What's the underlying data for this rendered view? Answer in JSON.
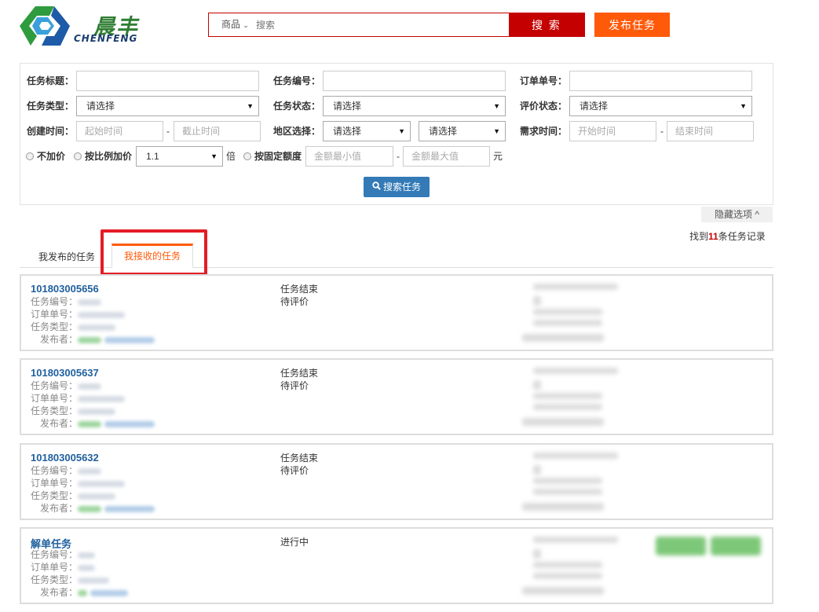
{
  "header": {
    "logo_cn": "晨丰",
    "logo_en": "CHENFENG",
    "search_category": "商品",
    "search_placeholder": "搜索",
    "search_button": "搜 索",
    "publish_button": "发布任务"
  },
  "filters": {
    "task_title_label": "任务标题：",
    "task_no_label": "任务编号：",
    "order_no_label": "订单单号：",
    "task_type_label": "任务类型：",
    "task_type_value": "请选择",
    "task_status_label": "任务状态：",
    "task_status_value": "请选择",
    "review_status_label": "评价状态：",
    "review_status_value": "请选择",
    "create_time_label": "创建时间：",
    "start_time_placeholder": "起始时间",
    "end_time_placeholder": "截止时间",
    "region_label": "地区选择：",
    "region_value_1": "请选择",
    "region_value_2": "请选择",
    "demand_time_label": "需求时间：",
    "demand_start_placeholder": "开始时间",
    "demand_end_placeholder": "结束时间",
    "radio_no_markup": "不加价",
    "radio_ratio_markup": "按比例加价",
    "ratio_value": "1.1",
    "ratio_unit": "倍",
    "radio_fixed_markup": "按固定额度",
    "min_amount_placeholder": "金额最小值",
    "max_amount_placeholder": "金额最大值",
    "amount_unit": "元",
    "search_task_button": "搜索任务",
    "dash": "-"
  },
  "hide_options": "隐藏选项 ^",
  "result": {
    "prefix": "找到",
    "count": "11",
    "suffix": "条任务记录"
  },
  "tabs": [
    {
      "label": "我发布的任务"
    },
    {
      "label": "我接收的任务"
    }
  ],
  "field_labels": {
    "task_no": "任务编号：",
    "order_no": "订单单号：",
    "task_type": "任务类型：",
    "publisher": "发布者："
  },
  "tasks": [
    {
      "id": "101803005656",
      "status1": "任务结束",
      "status2": "待评价"
    },
    {
      "id": "101803005637",
      "status1": "任务结束",
      "status2": "待评价"
    },
    {
      "id": "101803005632",
      "status1": "任务结束",
      "status2": "待评价"
    },
    {
      "id": "解单任务",
      "status1": "进行中",
      "status2": ""
    }
  ],
  "colors": {
    "brand_red": "#c40000",
    "orange": "#ff5a0a",
    "link_blue": "#1f5f9e",
    "button_blue": "#337ab7"
  }
}
